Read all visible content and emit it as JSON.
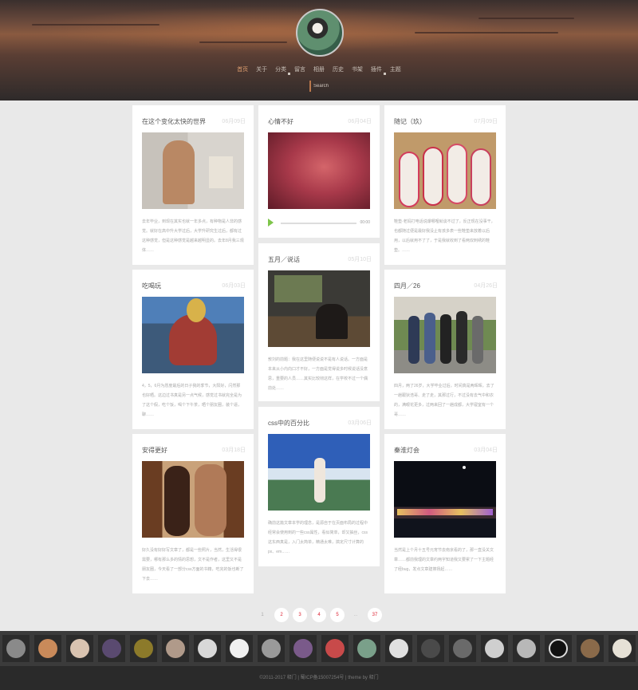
{
  "nav": {
    "items": [
      {
        "label": "首页",
        "active": true,
        "caret": false
      },
      {
        "label": "关于",
        "active": false,
        "caret": false
      },
      {
        "label": "分类",
        "active": false,
        "caret": true
      },
      {
        "label": "留言",
        "active": false,
        "caret": false
      },
      {
        "label": "相册",
        "active": false,
        "caret": false
      },
      {
        "label": "历史",
        "active": false,
        "caret": false
      },
      {
        "label": "书架",
        "active": false,
        "caret": false
      },
      {
        "label": "插件",
        "active": false,
        "caret": true
      },
      {
        "label": "主题",
        "active": false,
        "caret": false
      }
    ],
    "search_placeholder": "Search"
  },
  "cards": [
    {
      "title": "在这个变化太快的世界",
      "date": "06月09日",
      "image": "photo-man-mirror",
      "text": "去年毕业，到现在其实也就一年多点，有种物是人非的感觉。就好在高中升大学过后，大学升研究生过后，都有过这种感觉，但是这种感觉是越来越明显的。去年8月我三观体……"
    },
    {
      "title": "心情不好",
      "date": "06月04日",
      "image": "photo-red-blur",
      "audio_time": "00:00"
    },
    {
      "title": "随记（玖）",
      "date": "07月09日",
      "image": "photo-embroidered-insoles",
      "text": "鞋垫·老妈打电话说爆哪哩就谈不过了，反正现在没事干，也都随过便是最好我没止有孩多表一些鞋垫来放着以后用，以后就用不了了，于是我就收到了看两双刺绣的鞋垫。……"
    },
    {
      "title": "五月／说话",
      "date": "05月10日",
      "image": "photo-restaurant",
      "text": "敖刘的前题：我在这里随便说说不是有人说话。一方面是本来从小内向口才不好，一方面是觉得说多时候说话没意思，重要的人员……其实比较彻这样，在学校不过一个偶前处……"
    },
    {
      "title": "吃喝玩",
      "date": "06月03日",
      "image": "photo-grilled-food",
      "text": "4，5，6月为愿度最后的日子我的季节，大阳好，闪然那也好晒。这边过书真是另一点气候，感觉过书就完全是为了这个假，吃个饭，喝个下午茶，晒个朋友圈，装个逼，聊……"
    },
    {
      "title": "四月／26",
      "date": "04月26日",
      "image": "photo-group",
      "text": "四月，两了26岁，大学毕业过后，时间真是两晖晖，去了一趟跟狄浩哥、走了走，其那过行，不过没有去气中和衣的，满眼花更多，过两来回了一趟成都，大学寝室有一个哥……"
    },
    {
      "title": "css中的百分比",
      "date": "03月06日",
      "image": "photo-lake-girl",
      "text": "确前这篇文章本学的理念，是源自于在页面布局的过程中经常会使用到的一些css属性，看似简单，却又抽丝，css这东西真是，入门太简单，精通太难，搞定尺寸计算的px、em……"
    },
    {
      "title": "安得更好",
      "date": "03月18日",
      "image": "photo-couple",
      "text": "好久没有好好写文章了，都是一些照片，当然，生活得很需要，哪有那么多的情的思想，文不是作者，这里又不是朋友圈，今天看了一部分css方面的书籍，吃完的饭也断了下去……"
    },
    {
      "title": "秦淮灯会",
      "date": "03月04日",
      "image": "photo-night-lights",
      "text": "当然是上个月十五号元宵节去南京看的了，那一直没关文章……都前我理的文章约两字知道我又要累了一下主题经了经bug，发点文章建擦扬起……"
    }
  ],
  "pagination": {
    "pages": [
      "1",
      "2",
      "3",
      "4",
      "5",
      "...",
      "37"
    ],
    "current": "1"
  },
  "friends": [
    "avatar-1",
    "avatar-2",
    "avatar-3",
    "avatar-4",
    "avatar-5",
    "avatar-6",
    "avatar-7",
    "avatar-8",
    "avatar-9",
    "avatar-10",
    "avatar-11",
    "avatar-12",
    "avatar-13",
    "avatar-14",
    "avatar-15",
    "avatar-16",
    "avatar-17",
    "avatar-18",
    "avatar-19",
    "avatar-20"
  ],
  "footer": {
    "text": "©2011-2017 释门 | 蜀ICP备15007254号 | theme by 释门"
  }
}
